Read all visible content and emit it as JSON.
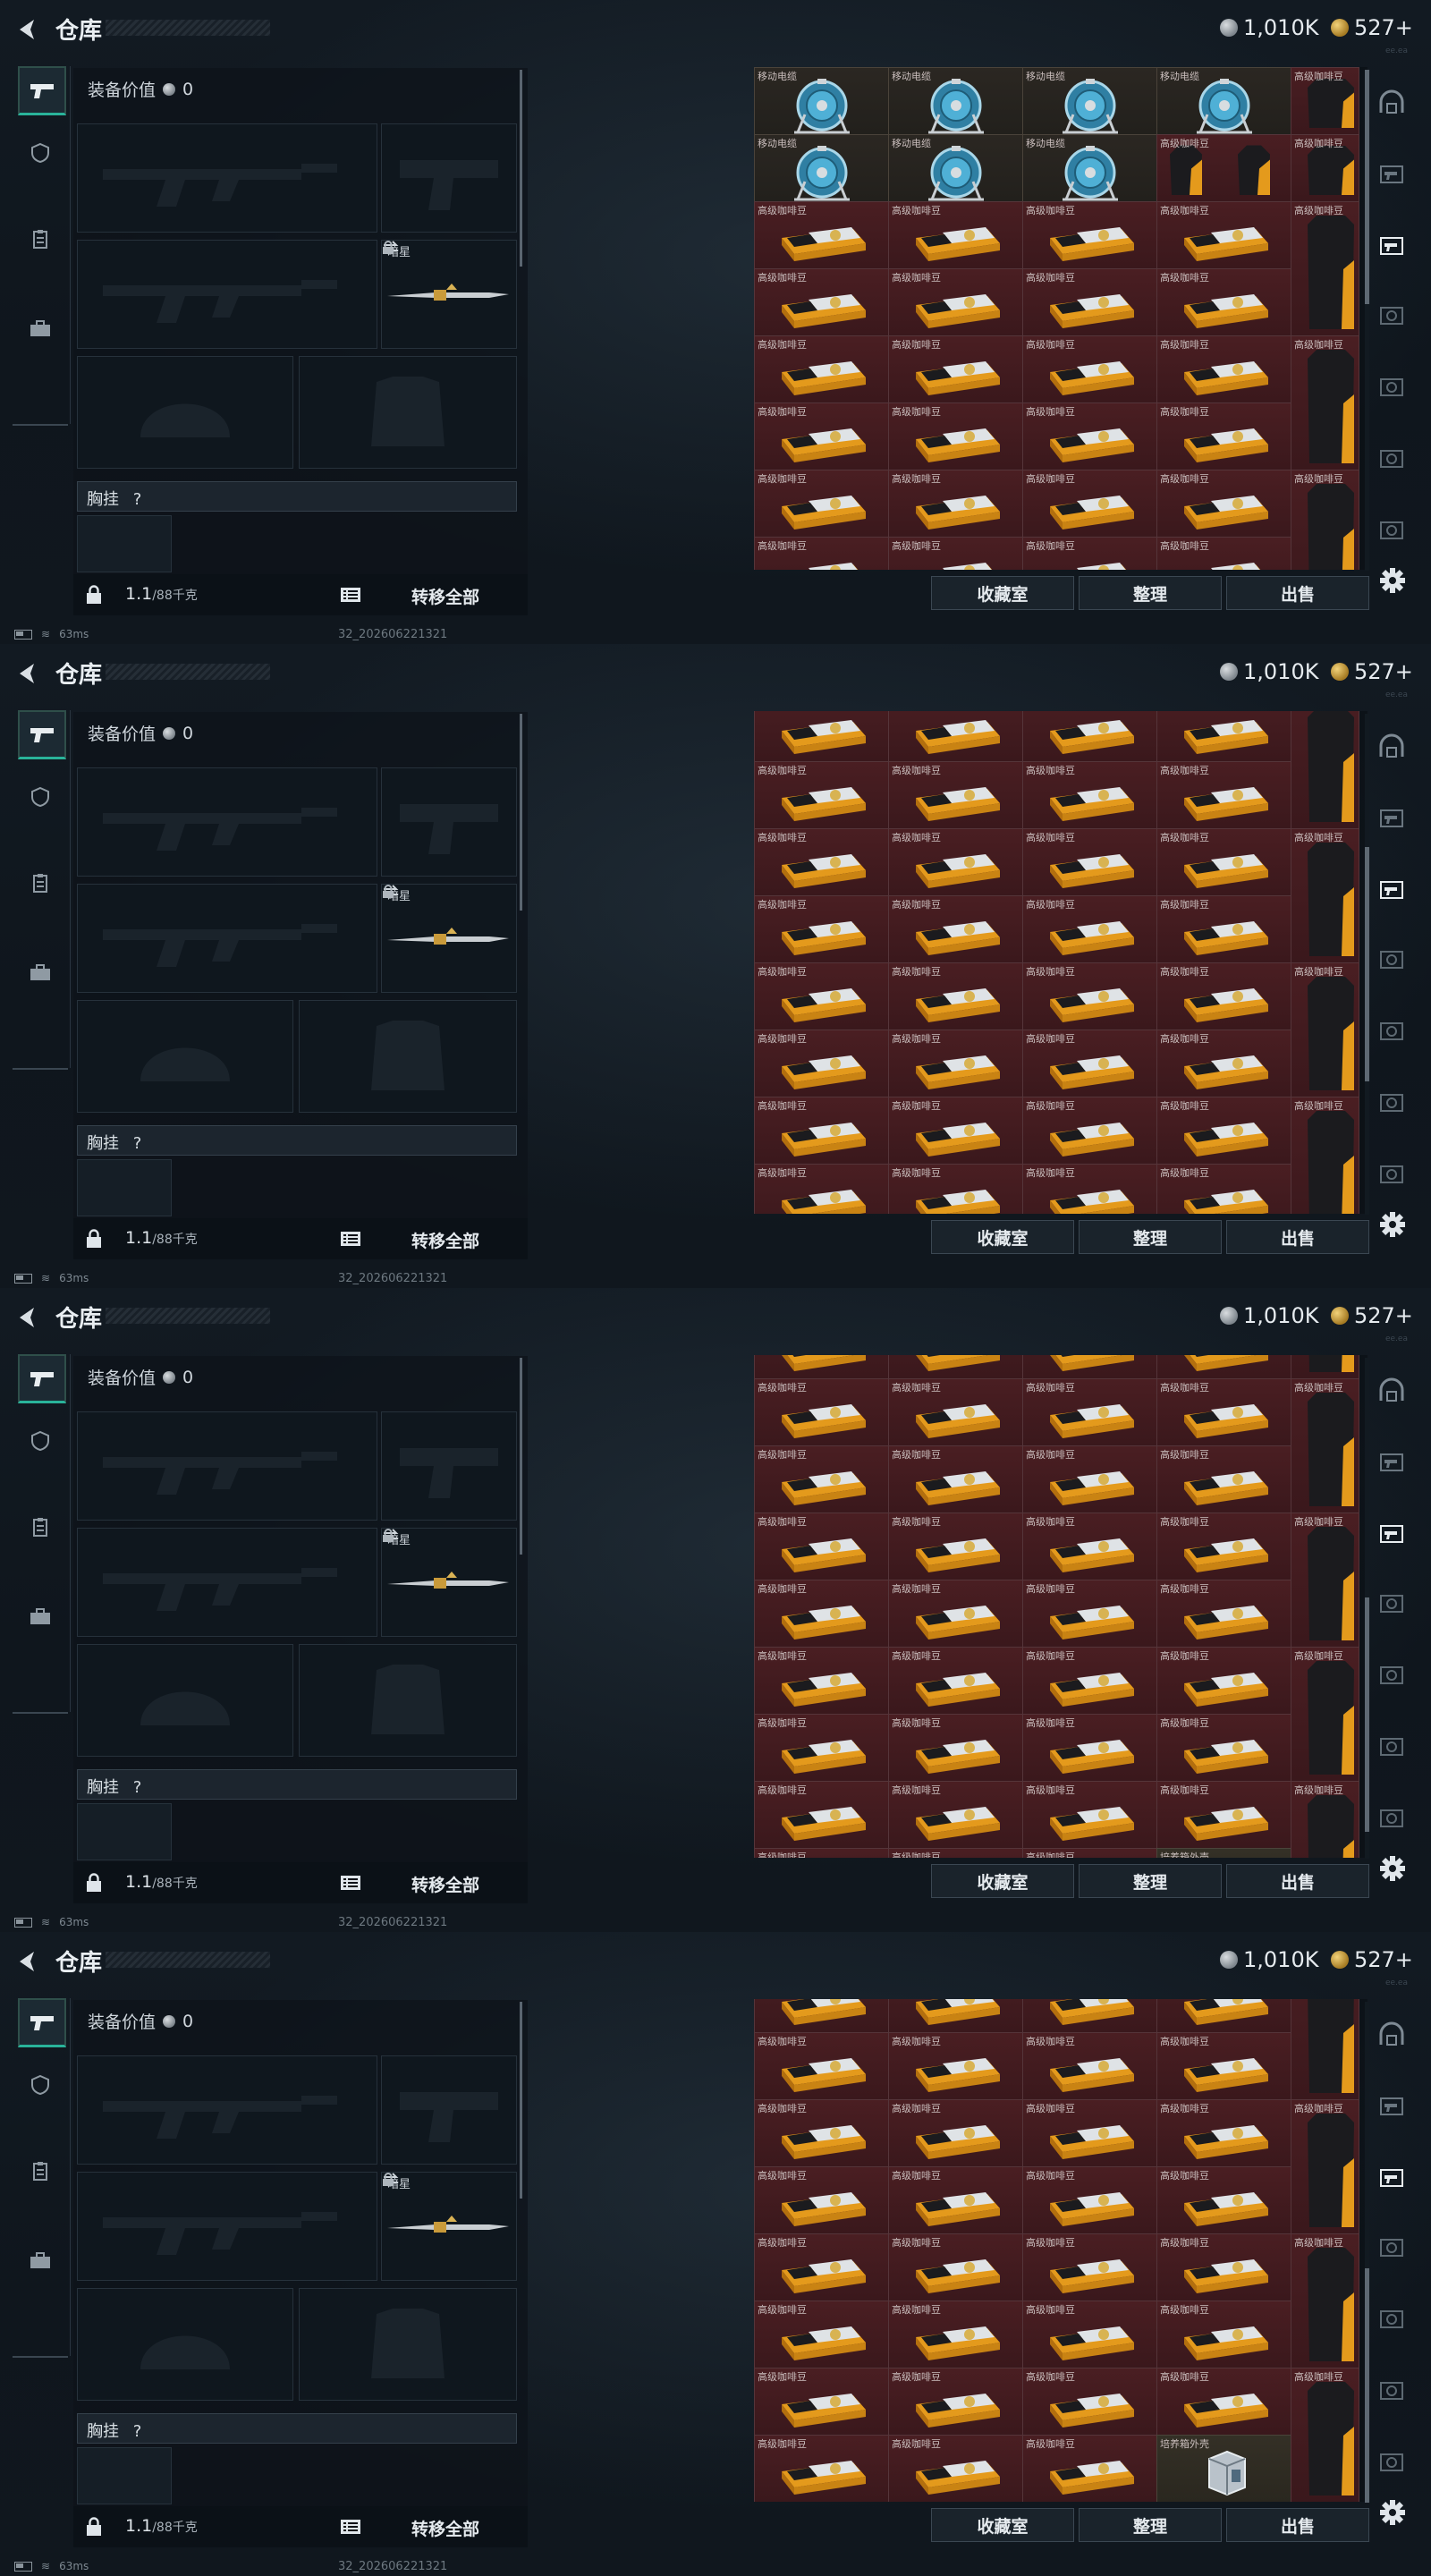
{
  "header": {
    "title": "仓库",
    "silver_amount": "1,010K",
    "gold_amount": "527+",
    "back_icon": "chevron-left-icon",
    "top_right_faint": "ee.ea"
  },
  "left_nav": {
    "items": [
      {
        "name": "pistol-icon",
        "active": true
      },
      {
        "name": "helmet-badge-icon",
        "active": false
      },
      {
        "name": "clipboard-icon",
        "active": false
      },
      {
        "name": "briefcase-icon",
        "active": false
      }
    ]
  },
  "equipment": {
    "value_label": "装备价值",
    "value": "0",
    "melee_label": "暗星",
    "chest_label": "胸挂",
    "chest_help": "?",
    "weight": "1.1",
    "weight_max": "/88千克",
    "transfer_all": "转移全部"
  },
  "stash": {
    "labels": {
      "coffee": "高级咖啡豆",
      "reel": "移动电缆",
      "box": "培养箱外壳"
    },
    "colors": {
      "coffee_bg": "#4a1e22",
      "reel_bg": "#2b2722",
      "accent": "#29b39a"
    },
    "actions": {
      "collection": "收藏室",
      "organize": "整理",
      "sell": "出售"
    },
    "scroll_positions": [
      0,
      0.5,
      0.9,
      1.0
    ]
  },
  "status": {
    "ping": "63ms",
    "build": "32_202606221321"
  },
  "right_rail": [
    "dome-icon",
    "gun-layer-icon",
    "gun-active-icon",
    "layer-icon",
    "layer-icon",
    "layer-icon",
    "layer-icon",
    "layer-icon",
    "settings-gear-icon"
  ]
}
